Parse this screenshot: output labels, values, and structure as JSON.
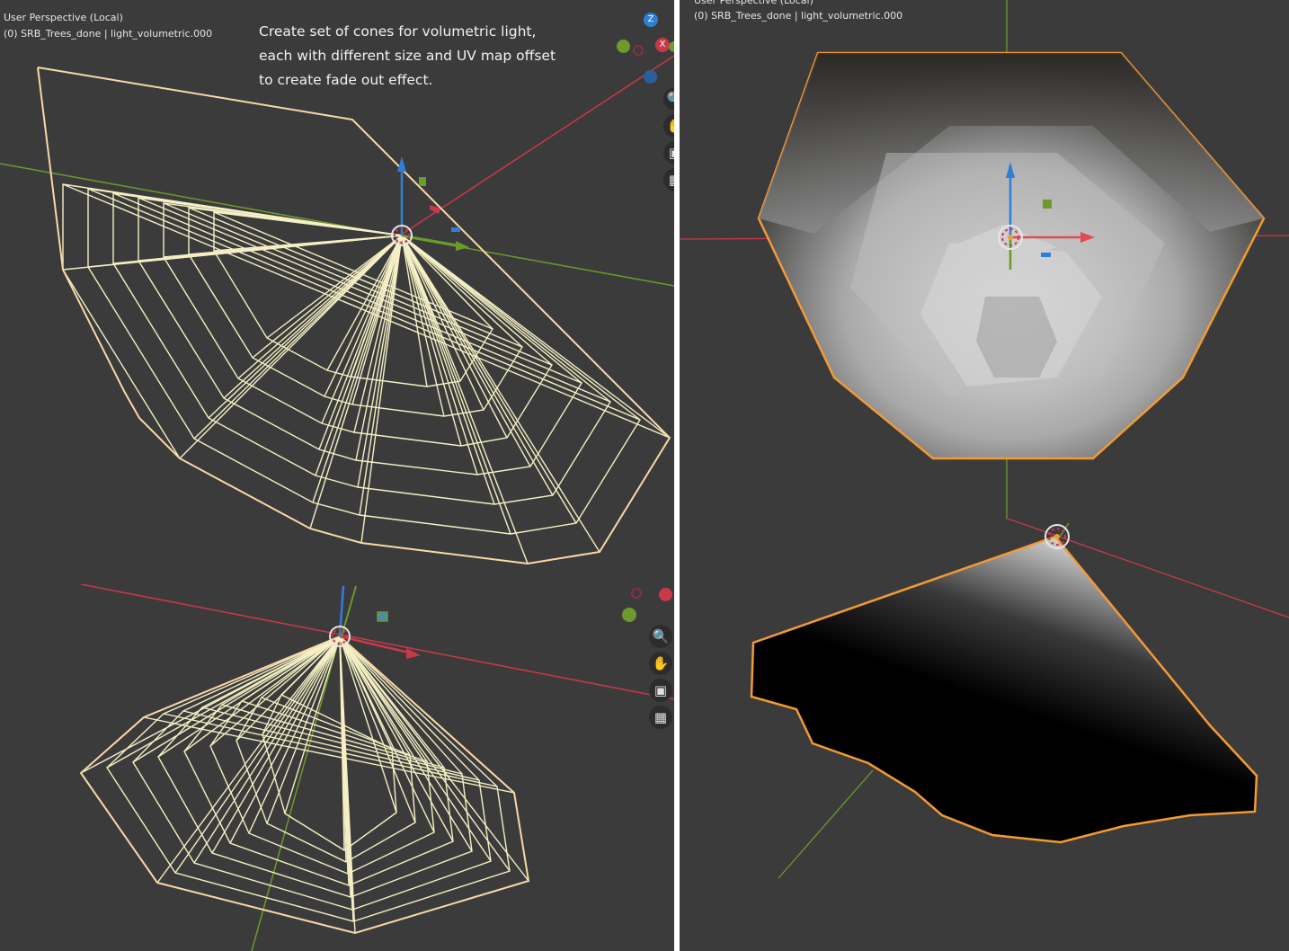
{
  "app": "Blender 3D Viewport",
  "viewports": {
    "top_left": {
      "header_line1": "User Perspective (Local)",
      "header_line2": "(0) SRB_Trees_done | light_volumetric.000",
      "annotation": [
        "Create set of cones for volumetric light,",
        "each with different size and UV map offset",
        "to create fade out effect."
      ],
      "shading": "wireframe",
      "gizmo_labels": {
        "z": "Z",
        "x": "X"
      }
    },
    "bottom_left": {
      "shading": "wireframe"
    },
    "top_right": {
      "header_line1": "User Perspective (Local)",
      "header_line2": "(0) SRB_Trees_done | light_volumetric.000",
      "shading": "solid"
    },
    "bottom_right": {
      "shading": "material preview"
    }
  },
  "nav_tools": [
    {
      "name": "zoom",
      "icon": "magnifier-icon"
    },
    {
      "name": "pan",
      "icon": "hand-icon"
    },
    {
      "name": "camera",
      "icon": "camera-icon"
    },
    {
      "name": "ortho",
      "icon": "grid-icon"
    }
  ],
  "colors": {
    "viewport_bg": "#3b3b3b",
    "wire_selected": "#f4efc4",
    "outline_active": "#f29a35",
    "axis_x": "#c8394a",
    "axis_y": "#6d9a2c",
    "gizmo_z": "#2f7fd6",
    "separator": "#ffffff"
  }
}
